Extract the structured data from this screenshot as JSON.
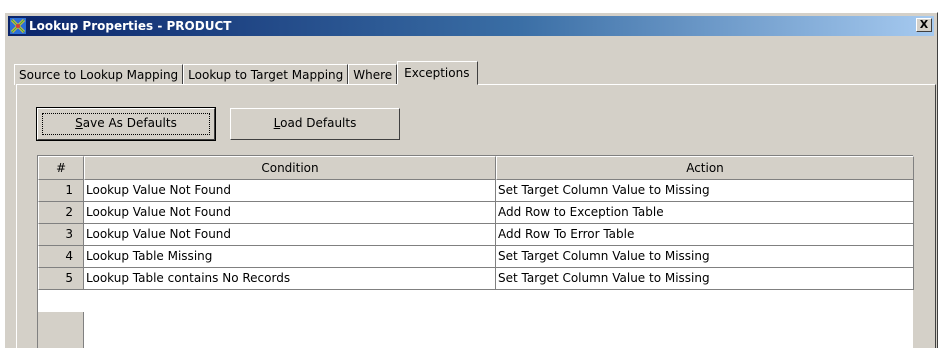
{
  "window": {
    "title": "Lookup Properties - PRODUCT",
    "close_glyph": "X"
  },
  "tabs": [
    {
      "label": "Source to Lookup Mapping",
      "active": false
    },
    {
      "label": "Lookup to Target Mapping",
      "active": false
    },
    {
      "label": "Where",
      "active": false
    },
    {
      "label": "Exceptions",
      "active": true
    }
  ],
  "buttons": {
    "save_defaults": {
      "mnemonic": "S",
      "rest": "ave As Defaults"
    },
    "load_defaults": {
      "mnemonic": "L",
      "rest": "oad Defaults"
    }
  },
  "table": {
    "headers": {
      "num": "#",
      "condition": "Condition",
      "action": "Action"
    },
    "rows": [
      {
        "num": "1",
        "condition": "Lookup Value Not Found",
        "action": "Set Target Column Value to Missing"
      },
      {
        "num": "2",
        "condition": "Lookup Value Not Found",
        "action": "Add Row to Exception Table"
      },
      {
        "num": "3",
        "condition": "Lookup Value Not Found",
        "action": "Add Row To Error Table"
      },
      {
        "num": "4",
        "condition": "Lookup Table Missing",
        "action": "Set Target Column Value to Missing"
      },
      {
        "num": "5",
        "condition": "Lookup Table contains No Records",
        "action": "Set Target Column Value to Missing"
      }
    ]
  },
  "colors": {
    "titlebar_start": "#0a246a",
    "titlebar_end": "#a6caf0",
    "face": "#d4d0c8"
  },
  "icons": {
    "app": "etl-process-icon",
    "close": "close-icon"
  }
}
